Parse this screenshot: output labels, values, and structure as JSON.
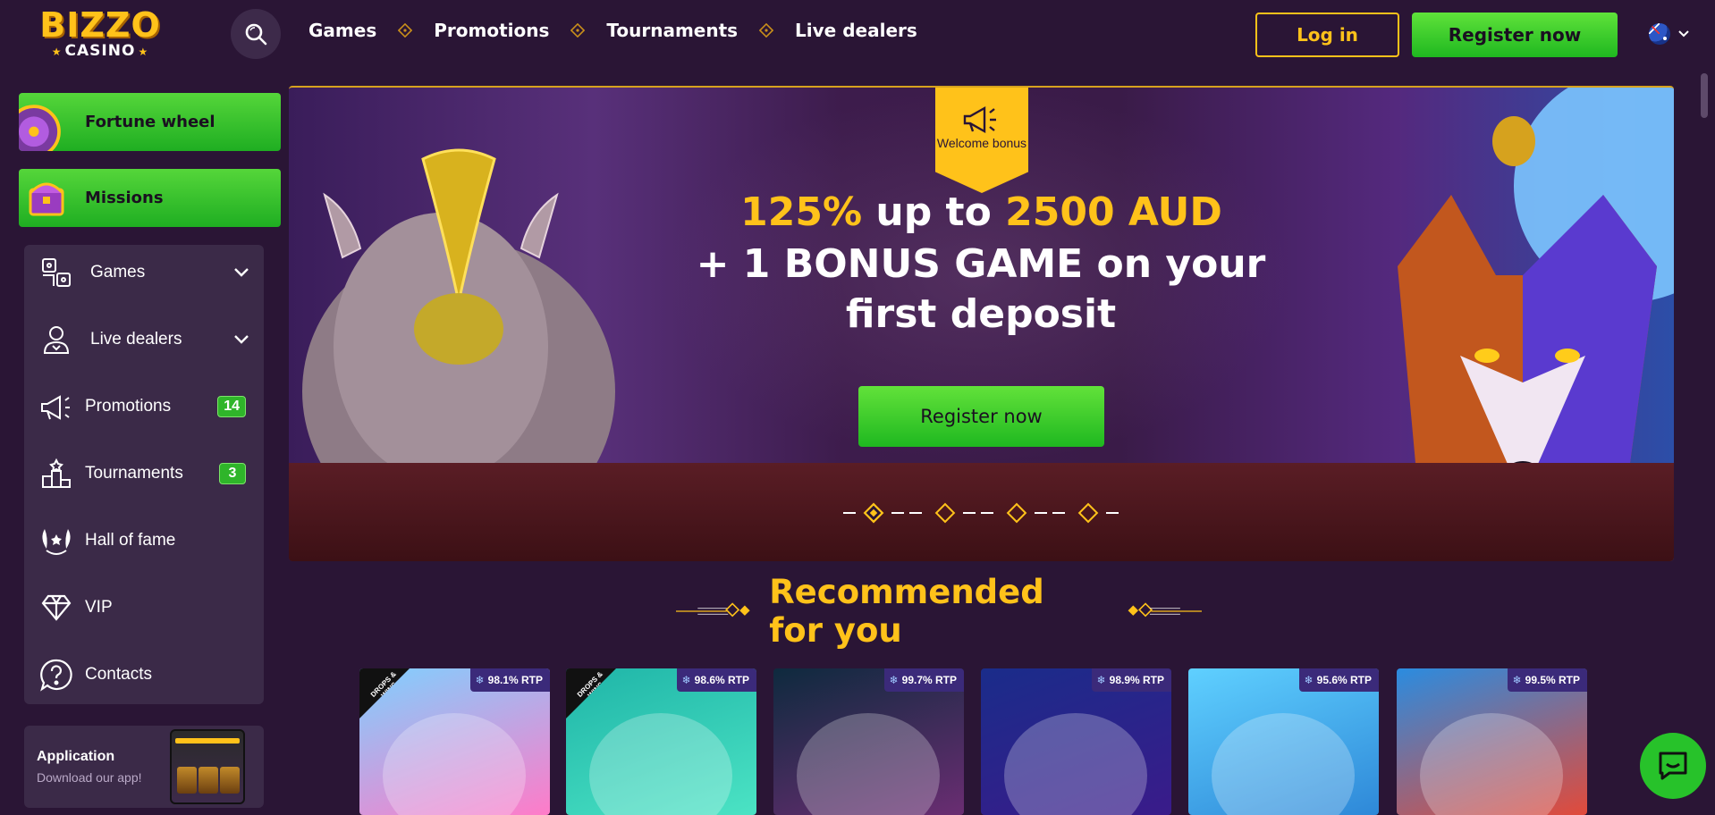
{
  "header": {
    "logo_top": "BIZZO",
    "logo_bottom": "CASINO",
    "nav": [
      "Games",
      "Promotions",
      "Tournaments",
      "Live dealers"
    ],
    "login_label": "Log in",
    "register_label": "Register now"
  },
  "sidebar": {
    "fortune_wheel": "Fortune wheel",
    "missions": "Missions",
    "items": [
      {
        "label": "Games",
        "icon": "games-icon"
      },
      {
        "label": "Live dealers",
        "icon": "dealer-icon"
      },
      {
        "label": "Promotions",
        "icon": "megaphone-icon",
        "badge": "14"
      },
      {
        "label": "Tournaments",
        "icon": "podium-icon",
        "badge": "3"
      },
      {
        "label": "Hall of fame",
        "icon": "laurel-icon"
      },
      {
        "label": "VIP",
        "icon": "diamond-icon"
      },
      {
        "label": "Contacts",
        "icon": "help-icon"
      }
    ],
    "app": {
      "title": "Application",
      "subtitle": "Download our app!"
    }
  },
  "hero": {
    "tag": "Welcome bonus",
    "line1_pct": "125%",
    "line1_mid": " up to ",
    "line1_amount": "2500 AUD",
    "line2": "+ 1 BONUS GAME on your first deposit",
    "cta": "Register now",
    "slides": 4,
    "active_slide": 1
  },
  "recommended": {
    "title": "Recommended for you",
    "games": [
      {
        "rtp": "98.1% RTP",
        "drops": true,
        "bg": [
          "#7fd0ff",
          "#ff7bc8"
        ]
      },
      {
        "rtp": "98.6% RTP",
        "drops": true,
        "bg": [
          "#1fb5a8",
          "#4be3c4"
        ]
      },
      {
        "rtp": "99.7% RTP",
        "drops": false,
        "bg": [
          "#0e2a3e",
          "#6a2d72"
        ]
      },
      {
        "rtp": "98.9% RTP",
        "drops": false,
        "bg": [
          "#1a2c8a",
          "#3a1b8a"
        ]
      },
      {
        "rtp": "95.6% RTP",
        "drops": false,
        "bg": [
          "#5fd0ff",
          "#2e88d8"
        ]
      },
      {
        "rtp": "99.5% RTP",
        "drops": false,
        "bg": [
          "#2a8ce0",
          "#e24a3a"
        ]
      }
    ],
    "drops_label": "DROPS & WINS"
  },
  "colors": {
    "accent": "#ffc21a",
    "green": "#2fb52a",
    "bg": "#2a1535"
  }
}
